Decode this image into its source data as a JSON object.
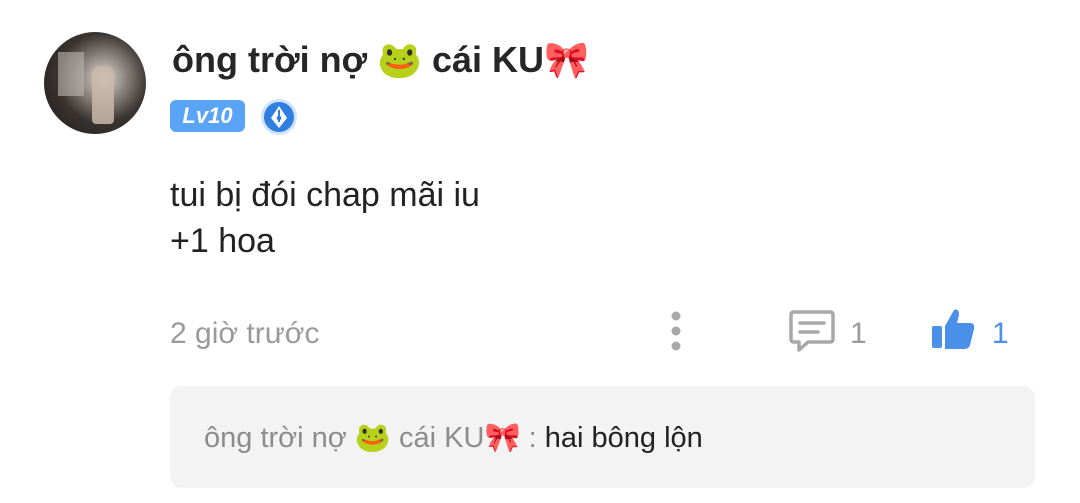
{
  "comment": {
    "username": "ông trời nợ 🐸 cái KU🎀",
    "level_badge": "Lv10",
    "lines": [
      "tui bị đói chap mãi iu",
      "+1 hoa"
    ],
    "time": "2 giờ trước",
    "reply_count": "1",
    "like_count": "1",
    "accent_color": "#4a90e8",
    "level_color": "#5aa4f7"
  },
  "icons": {
    "badge": "pen-nib-badge-icon",
    "more": "more-vertical-icon",
    "reply": "comment-icon",
    "like": "thumbs-up-icon"
  },
  "reply": {
    "username": "ông trời nợ 🐸 cái KU🎀",
    "separator": ":",
    "text": "hai bông lộn"
  }
}
